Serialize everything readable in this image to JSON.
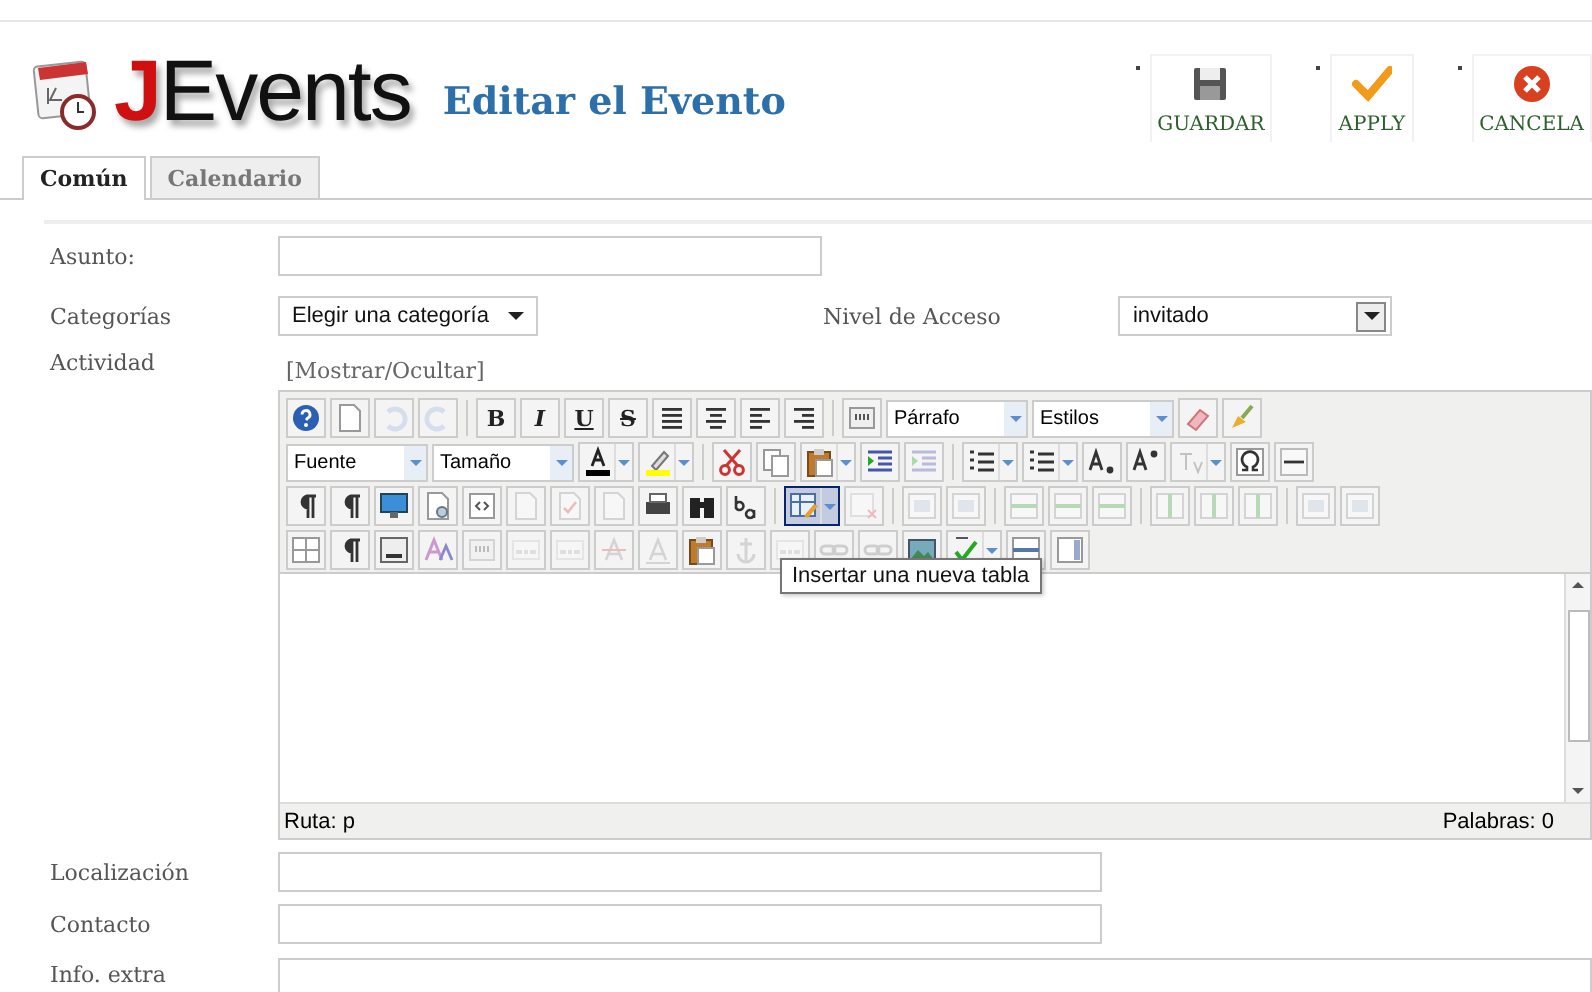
{
  "header": {
    "logo": {
      "accent": "J",
      "rest": "Events"
    },
    "title": "Editar el Evento",
    "actions": [
      {
        "kind": "save",
        "label": "GUARDAR"
      },
      {
        "kind": "apply",
        "label": "APPLY"
      },
      {
        "kind": "cancel",
        "label": "CANCELA"
      }
    ]
  },
  "tabs": [
    {
      "label": "Común",
      "selected": true
    },
    {
      "label": "Calendario",
      "selected": false
    }
  ],
  "form": {
    "subject": {
      "label": "Asunto:"
    },
    "category": {
      "label": "Categorías",
      "value": "Elegir una categoría"
    },
    "access": {
      "label": "Nivel de Acceso",
      "value": "invitado"
    },
    "activity": {
      "label": "Actividad",
      "toggle": "[Mostrar/Ocultar]"
    },
    "editor": {
      "toolbar": [
        [
          {
            "kind": "button",
            "disabled": false,
            "active": false
          },
          {
            "kind": "button",
            "disabled": false,
            "active": false
          },
          {
            "kind": "button",
            "disabled": true,
            "active": false
          },
          {
            "kind": "button",
            "disabled": true,
            "active": false
          },
          {
            "kind": "separator"
          },
          {
            "kind": "text",
            "label": "B",
            "disabled": false,
            "active": false
          },
          {
            "kind": "text",
            "label": "I",
            "disabled": false,
            "active": false
          },
          {
            "kind": "text",
            "label": "U",
            "disabled": false,
            "active": false
          },
          {
            "kind": "text",
            "label": "S",
            "disabled": false,
            "active": false
          },
          {
            "kind": "button",
            "disabled": false,
            "active": false
          },
          {
            "kind": "button",
            "disabled": false,
            "active": false
          },
          {
            "kind": "button",
            "disabled": false,
            "active": false
          },
          {
            "kind": "button",
            "disabled": false,
            "active": false
          },
          {
            "kind": "separator"
          },
          {
            "kind": "button",
            "disabled": false,
            "active": false
          },
          {
            "kind": "select",
            "value": "Párrafo"
          },
          {
            "kind": "select",
            "value": "Estilos"
          },
          {
            "kind": "button",
            "disabled": false,
            "active": false
          },
          {
            "kind": "button",
            "disabled": false,
            "active": false
          }
        ],
        [
          {
            "kind": "select",
            "value": "Fuente"
          },
          {
            "kind": "select",
            "value": "Tamaño"
          },
          {
            "kind": "split",
            "disabled": false,
            "active": false
          },
          {
            "kind": "split",
            "disabled": false,
            "active": false
          },
          {
            "kind": "separator"
          },
          {
            "kind": "button",
            "disabled": false,
            "active": false
          },
          {
            "kind": "button",
            "disabled": false,
            "active": false
          },
          {
            "kind": "split",
            "disabled": false,
            "active": false
          },
          {
            "kind": "button",
            "disabled": false,
            "active": false
          },
          {
            "kind": "button",
            "disabled": true,
            "active": false
          },
          {
            "kind": "separator"
          },
          {
            "kind": "split",
            "disabled": false,
            "active": false
          },
          {
            "kind": "split",
            "disabled": false,
            "active": false
          },
          {
            "kind": "button",
            "disabled": false,
            "active": false
          },
          {
            "kind": "button",
            "disabled": false,
            "active": false
          },
          {
            "kind": "split",
            "disabled": true,
            "active": false
          },
          {
            "kind": "button",
            "disabled": false,
            "active": false
          },
          {
            "kind": "button",
            "disabled": false,
            "active": false
          }
        ],
        [
          {
            "kind": "button",
            "disabled": false,
            "active": false
          },
          {
            "kind": "button",
            "disabled": false,
            "active": false
          },
          {
            "kind": "button",
            "disabled": false,
            "active": false
          },
          {
            "kind": "button",
            "disabled": false,
            "active": false
          },
          {
            "kind": "button",
            "disabled": false,
            "active": false
          },
          {
            "kind": "button",
            "disabled": true,
            "active": false
          },
          {
            "kind": "button",
            "disabled": true,
            "active": false
          },
          {
            "kind": "button",
            "disabled": true,
            "active": false
          },
          {
            "kind": "button",
            "disabled": false,
            "active": false
          },
          {
            "kind": "button",
            "disabled": false,
            "active": false
          },
          {
            "kind": "button",
            "disabled": false,
            "active": false
          },
          {
            "kind": "separator"
          },
          {
            "kind": "split",
            "disabled": false,
            "active": true
          },
          {
            "kind": "button",
            "disabled": true,
            "active": false
          },
          {
            "kind": "separator"
          },
          {
            "kind": "button",
            "disabled": true,
            "active": false
          },
          {
            "kind": "button",
            "disabled": true,
            "active": false
          },
          {
            "kind": "separator"
          },
          {
            "kind": "button",
            "disabled": true,
            "active": false
          },
          {
            "kind": "button",
            "disabled": true,
            "active": false
          },
          {
            "kind": "button",
            "disabled": true,
            "active": false
          },
          {
            "kind": "separator"
          },
          {
            "kind": "button",
            "disabled": true,
            "active": false
          },
          {
            "kind": "button",
            "disabled": true,
            "active": false
          },
          {
            "kind": "button",
            "disabled": true,
            "active": false
          },
          {
            "kind": "separator"
          },
          {
            "kind": "button",
            "disabled": true,
            "active": false
          },
          {
            "kind": "button",
            "disabled": true,
            "active": false
          }
        ],
        [
          {
            "kind": "button",
            "disabled": false,
            "active": false
          },
          {
            "kind": "button",
            "disabled": false,
            "active": false
          },
          {
            "kind": "button",
            "disabled": false,
            "active": false
          },
          {
            "kind": "button",
            "disabled": false,
            "active": false
          },
          {
            "kind": "button",
            "disabled": true,
            "active": false
          },
          {
            "kind": "button",
            "disabled": true,
            "active": false
          },
          {
            "kind": "button",
            "disabled": true,
            "active": false
          },
          {
            "kind": "button",
            "disabled": true,
            "active": false
          },
          {
            "kind": "button",
            "disabled": true,
            "active": false
          },
          {
            "kind": "button",
            "disabled": false,
            "active": false
          },
          {
            "kind": "button",
            "disabled": true,
            "active": false
          },
          {
            "kind": "button",
            "disabled": true,
            "active": false
          },
          {
            "kind": "button",
            "disabled": true,
            "active": false
          },
          {
            "kind": "button",
            "disabled": true,
            "active": false
          },
          {
            "kind": "button",
            "disabled": false,
            "active": false
          },
          {
            "kind": "split",
            "disabled": false,
            "active": false
          },
          {
            "kind": "button",
            "disabled": false,
            "active": false
          },
          {
            "kind": "button",
            "disabled": false,
            "active": false
          }
        ]
      ],
      "tooltip": "Insertar una nueva tabla",
      "path": "Ruta: p",
      "word_count": "Palabras: 0"
    },
    "location": {
      "label": "Localización"
    },
    "contact": {
      "label": "Contacto"
    },
    "extra": {
      "label": "Info. extra"
    }
  }
}
